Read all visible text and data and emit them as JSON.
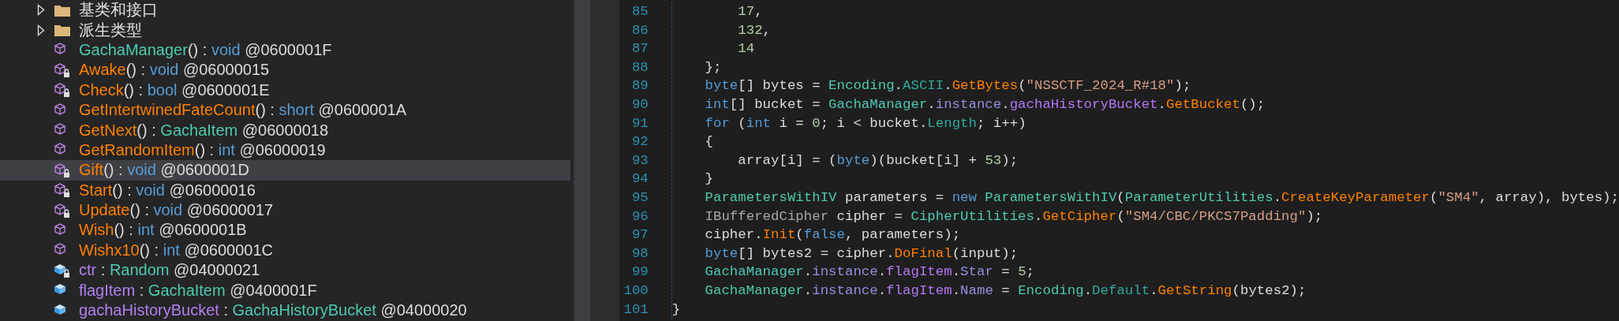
{
  "tree": {
    "items": [
      {
        "kind": "folder",
        "name": "基类和接口",
        "expanded": false,
        "selected": false
      },
      {
        "kind": "folder",
        "name": "派生类型",
        "expanded": false,
        "selected": false
      },
      {
        "kind": "constructor",
        "private": false,
        "name": "GachaManager",
        "parens": "()",
        "sep": ":",
        "returns": {
          "kind": "keyword",
          "text": "void"
        },
        "token": "@0600001F",
        "selected": false
      },
      {
        "kind": "method",
        "private": true,
        "name": "Awake",
        "parens": "()",
        "sep": ":",
        "returns": {
          "kind": "keyword",
          "text": "void"
        },
        "token": "@06000015",
        "selected": false
      },
      {
        "kind": "method",
        "private": true,
        "name": "Check",
        "parens": "()",
        "sep": ":",
        "returns": {
          "kind": "keyword",
          "text": "bool"
        },
        "token": "@0600001E",
        "selected": false
      },
      {
        "kind": "method",
        "private": false,
        "name": "GetIntertwinedFateCount",
        "parens": "()",
        "sep": ":",
        "returns": {
          "kind": "keyword",
          "text": "short"
        },
        "token": "@0600001A",
        "selected": false
      },
      {
        "kind": "method",
        "private": false,
        "name": "GetNext",
        "parens": "()",
        "sep": ":",
        "returns": {
          "kind": "class",
          "text": "GachaItem"
        },
        "token": "@06000018",
        "selected": false
      },
      {
        "kind": "method",
        "private": false,
        "name": "GetRandomItem",
        "parens": "()",
        "sep": ":",
        "returns": {
          "kind": "keyword",
          "text": "int"
        },
        "token": "@06000019",
        "selected": false
      },
      {
        "kind": "method",
        "private": true,
        "name": "Gift",
        "parens": "()",
        "sep": ":",
        "returns": {
          "kind": "keyword",
          "text": "void"
        },
        "token": "@0600001D",
        "selected": true
      },
      {
        "kind": "method",
        "private": true,
        "name": "Start",
        "parens": "()",
        "sep": ":",
        "returns": {
          "kind": "keyword",
          "text": "void"
        },
        "token": "@06000016",
        "selected": false
      },
      {
        "kind": "method",
        "private": true,
        "name": "Update",
        "parens": "()",
        "sep": ":",
        "returns": {
          "kind": "keyword",
          "text": "void"
        },
        "token": "@06000017",
        "selected": false
      },
      {
        "kind": "method",
        "private": false,
        "name": "Wish",
        "parens": "()",
        "sep": ":",
        "returns": {
          "kind": "keyword",
          "text": "int"
        },
        "token": "@0600001B",
        "selected": false
      },
      {
        "kind": "method",
        "private": false,
        "name": "Wishx10",
        "parens": "()",
        "sep": ":",
        "returns": {
          "kind": "keyword",
          "text": "int"
        },
        "token": "@0600001C",
        "selected": false
      },
      {
        "kind": "field",
        "private": true,
        "name": "ctr",
        "sep": ":",
        "returns": {
          "kind": "class",
          "text": "Random"
        },
        "token": "@04000021",
        "selected": false
      },
      {
        "kind": "field",
        "private": false,
        "name": "flagItem",
        "sep": ":",
        "returns": {
          "kind": "class",
          "text": "GachaItem"
        },
        "token": "@0400001F",
        "selected": false
      },
      {
        "kind": "field",
        "private": false,
        "name": "gachaHistoryBucket",
        "sep": ":",
        "returns": {
          "kind": "class",
          "text": "GachaHistoryBucket"
        },
        "token": "@04000020",
        "selected": false
      }
    ]
  },
  "code": {
    "lines": [
      {
        "number": "85",
        "tokens": [
          {
            "kind": "num",
            "text": "        17"
          },
          {
            "kind": "plain",
            "text": ","
          }
        ]
      },
      {
        "number": "86",
        "tokens": [
          {
            "kind": "num",
            "text": "        132"
          },
          {
            "kind": "plain",
            "text": ","
          }
        ]
      },
      {
        "number": "87",
        "tokens": [
          {
            "kind": "num",
            "text": "        14"
          }
        ]
      },
      {
        "number": "88",
        "tokens": [
          {
            "kind": "plain",
            "text": "    };"
          }
        ]
      },
      {
        "number": "89",
        "tokens": [
          {
            "kind": "kw",
            "text": "    byte"
          },
          {
            "kind": "plain",
            "text": "[] bytes = "
          },
          {
            "kind": "type",
            "text": "Encoding"
          },
          {
            "kind": "plain",
            "text": "."
          },
          {
            "kind": "prop",
            "text": "ASCII"
          },
          {
            "kind": "plain",
            "text": "."
          },
          {
            "kind": "method",
            "text": "GetBytes"
          },
          {
            "kind": "plain",
            "text": "("
          },
          {
            "kind": "str",
            "text": "\"NSSCTF_2024_R#18\""
          },
          {
            "kind": "plain",
            "text": ");"
          }
        ]
      },
      {
        "number": "90",
        "tokens": [
          {
            "kind": "kw",
            "text": "    int"
          },
          {
            "kind": "plain",
            "text": "[] bucket = "
          },
          {
            "kind": "type",
            "text": "GachaManager"
          },
          {
            "kind": "plain",
            "text": "."
          },
          {
            "kind": "static",
            "text": "instance"
          },
          {
            "kind": "plain",
            "text": "."
          },
          {
            "kind": "field",
            "text": "gachaHistoryBucket"
          },
          {
            "kind": "plain",
            "text": "."
          },
          {
            "kind": "method",
            "text": "GetBucket"
          },
          {
            "kind": "plain",
            "text": "();"
          }
        ]
      },
      {
        "number": "91",
        "tokens": [
          {
            "kind": "kw",
            "text": "    for"
          },
          {
            "kind": "plain",
            "text": " ("
          },
          {
            "kind": "kw",
            "text": "int"
          },
          {
            "kind": "plain",
            "text": " i = "
          },
          {
            "kind": "num",
            "text": "0"
          },
          {
            "kind": "plain",
            "text": "; i < bucket."
          },
          {
            "kind": "prop",
            "text": "Length"
          },
          {
            "kind": "plain",
            "text": "; i++)"
          }
        ]
      },
      {
        "number": "92",
        "tokens": [
          {
            "kind": "plain",
            "text": "    {"
          }
        ]
      },
      {
        "number": "93",
        "tokens": [
          {
            "kind": "plain",
            "text": "        array[i] = ("
          },
          {
            "kind": "kw",
            "text": "byte"
          },
          {
            "kind": "plain",
            "text": ")(bucket[i] + "
          },
          {
            "kind": "num",
            "text": "53"
          },
          {
            "kind": "plain",
            "text": ");"
          }
        ]
      },
      {
        "number": "94",
        "tokens": [
          {
            "kind": "plain",
            "text": "    }"
          }
        ]
      },
      {
        "number": "95",
        "tokens": [
          {
            "kind": "type",
            "text": "    ParametersWithIV"
          },
          {
            "kind": "plain",
            "text": " parameters = "
          },
          {
            "kind": "kw",
            "text": "new"
          },
          {
            "kind": "type",
            "text": " ParametersWithIV"
          },
          {
            "kind": "plain",
            "text": "("
          },
          {
            "kind": "type",
            "text": "ParameterUtilities"
          },
          {
            "kind": "plain",
            "text": "."
          },
          {
            "kind": "method",
            "text": "CreateKeyParameter"
          },
          {
            "kind": "plain",
            "text": "("
          },
          {
            "kind": "str",
            "text": "\"SM4\""
          },
          {
            "kind": "plain",
            "text": ", array), bytes);"
          }
        ]
      },
      {
        "number": "96",
        "tokens": [
          {
            "kind": "iface",
            "text": "    IBufferedCipher"
          },
          {
            "kind": "plain",
            "text": " cipher = "
          },
          {
            "kind": "type",
            "text": "CipherUtilities"
          },
          {
            "kind": "plain",
            "text": "."
          },
          {
            "kind": "method",
            "text": "GetCipher"
          },
          {
            "kind": "plain",
            "text": "("
          },
          {
            "kind": "str",
            "text": "\"SM4/CBC/PKCS7Padding\""
          },
          {
            "kind": "plain",
            "text": ");"
          }
        ]
      },
      {
        "number": "97",
        "tokens": [
          {
            "kind": "plain",
            "text": "    cipher."
          },
          {
            "kind": "method",
            "text": "Init"
          },
          {
            "kind": "plain",
            "text": "("
          },
          {
            "kind": "kw",
            "text": "false"
          },
          {
            "kind": "plain",
            "text": ", parameters);"
          }
        ]
      },
      {
        "number": "98",
        "tokens": [
          {
            "kind": "kw",
            "text": "    byte"
          },
          {
            "kind": "plain",
            "text": "[] bytes2 = cipher."
          },
          {
            "kind": "method",
            "text": "DoFinal"
          },
          {
            "kind": "plain",
            "text": "(input);"
          }
        ]
      },
      {
        "number": "99",
        "tokens": [
          {
            "kind": "type",
            "text": "    GachaManager"
          },
          {
            "kind": "plain",
            "text": "."
          },
          {
            "kind": "static",
            "text": "instance"
          },
          {
            "kind": "plain",
            "text": "."
          },
          {
            "kind": "field",
            "text": "flagItem"
          },
          {
            "kind": "plain",
            "text": "."
          },
          {
            "kind": "static",
            "text": "Star"
          },
          {
            "kind": "plain",
            "text": " = "
          },
          {
            "kind": "num",
            "text": "5"
          },
          {
            "kind": "plain",
            "text": ";"
          }
        ]
      },
      {
        "number": "100",
        "tokens": [
          {
            "kind": "type",
            "text": "    GachaManager"
          },
          {
            "kind": "plain",
            "text": "."
          },
          {
            "kind": "static",
            "text": "instance"
          },
          {
            "kind": "plain",
            "text": "."
          },
          {
            "kind": "field",
            "text": "flagItem"
          },
          {
            "kind": "plain",
            "text": "."
          },
          {
            "kind": "static",
            "text": "Name"
          },
          {
            "kind": "plain",
            "text": " = "
          },
          {
            "kind": "type",
            "text": "Encoding"
          },
          {
            "kind": "plain",
            "text": "."
          },
          {
            "kind": "prop",
            "text": "Default"
          },
          {
            "kind": "plain",
            "text": "."
          },
          {
            "kind": "method",
            "text": "GetString"
          },
          {
            "kind": "plain",
            "text": "(bytes2);"
          }
        ]
      },
      {
        "number": "101",
        "tokens": [
          {
            "kind": "plain",
            "text": "}"
          }
        ]
      }
    ]
  }
}
